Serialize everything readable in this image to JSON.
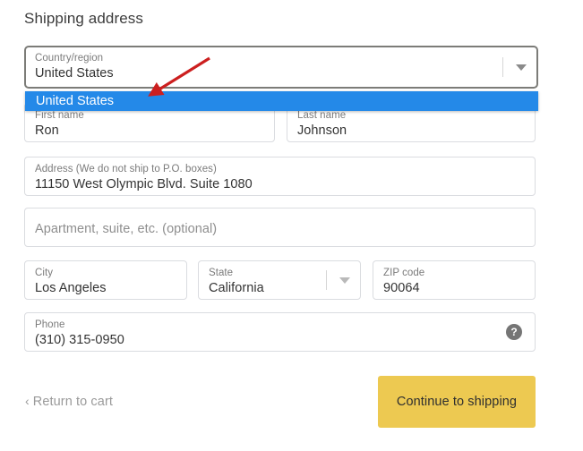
{
  "page": {
    "title": "Shipping address",
    "background_color": "#ffffff"
  },
  "colors": {
    "accent_button": "#edc951",
    "dropdown_highlight": "#2489e8",
    "annotation_arrow": "#cc1f1f",
    "field_border": "#dadce0",
    "field_border_focused": "#7c7c78",
    "label_text": "#7b7b7b",
    "value_text": "#333333"
  },
  "form": {
    "country": {
      "label": "Country/region",
      "value": "United States",
      "caret_icon": "chevron-down-icon"
    },
    "country_dropdown": {
      "open": true,
      "options": [
        {
          "label": "United States",
          "selected": true
        }
      ]
    },
    "first_name": {
      "label": "First name",
      "value": "Ron"
    },
    "last_name": {
      "label": "Last name",
      "value": "Johnson"
    },
    "address": {
      "label": "Address (We do not ship to P.O. boxes)",
      "value": "11150 West Olympic Blvd. Suite 1080"
    },
    "apartment": {
      "placeholder": "Apartment, suite, etc. (optional)",
      "value": ""
    },
    "city": {
      "label": "City",
      "value": "Los Angeles"
    },
    "state": {
      "label": "State",
      "value": "California",
      "caret_icon": "chevron-down-icon"
    },
    "zip": {
      "label": "ZIP code",
      "value": "90064"
    },
    "phone": {
      "label": "Phone",
      "value": "(310) 315-0950",
      "help_icon": "question-mark-circle-icon",
      "help_glyph": "?"
    }
  },
  "footer": {
    "return_link": "Return to cart",
    "return_chevron": "‹",
    "continue_button": "Continue to shipping"
  },
  "annotation": {
    "type": "arrow",
    "color": "#cc1f1f",
    "points_to": "United States"
  }
}
